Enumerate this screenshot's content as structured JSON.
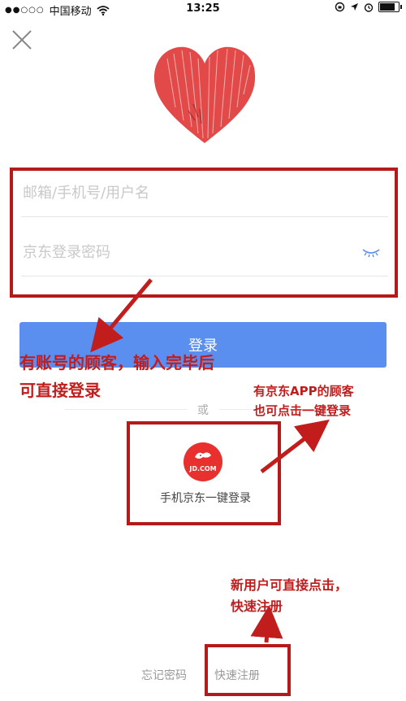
{
  "status_bar": {
    "signal": "●●○○○",
    "carrier": "中国移动",
    "wifi_icon": "wifi-icon",
    "time": "13:25",
    "battery_level": 0.85
  },
  "close_icon": "close-icon",
  "login_form": {
    "account_placeholder": "邮箱/手机号/用户名",
    "password_placeholder": "京东登录密码",
    "password_toggle_icon": "eye-closed-icon",
    "login_button": "登录"
  },
  "or_text": "或",
  "jd_app_login": {
    "logo_text": "JD.COM",
    "label": "手机京东一键登录"
  },
  "footer": {
    "forgot_password": "忘记密码",
    "quick_register": "快速注册"
  },
  "annotations": {
    "account_note_line1": "有账号的顾客，输入完毕后",
    "account_note_line2": "可直接登录",
    "app_note_line1": "有京东APP的顾客",
    "app_note_line2": "也可点击一键登录",
    "register_note_line1": "新用户可直接点击，",
    "register_note_line2": "快速注册"
  },
  "colors": {
    "login_button": "#5a8ff0",
    "annotation_red": "#c21d1d",
    "heart_red": "#e24a4a",
    "jd_red": "#e8312e"
  }
}
